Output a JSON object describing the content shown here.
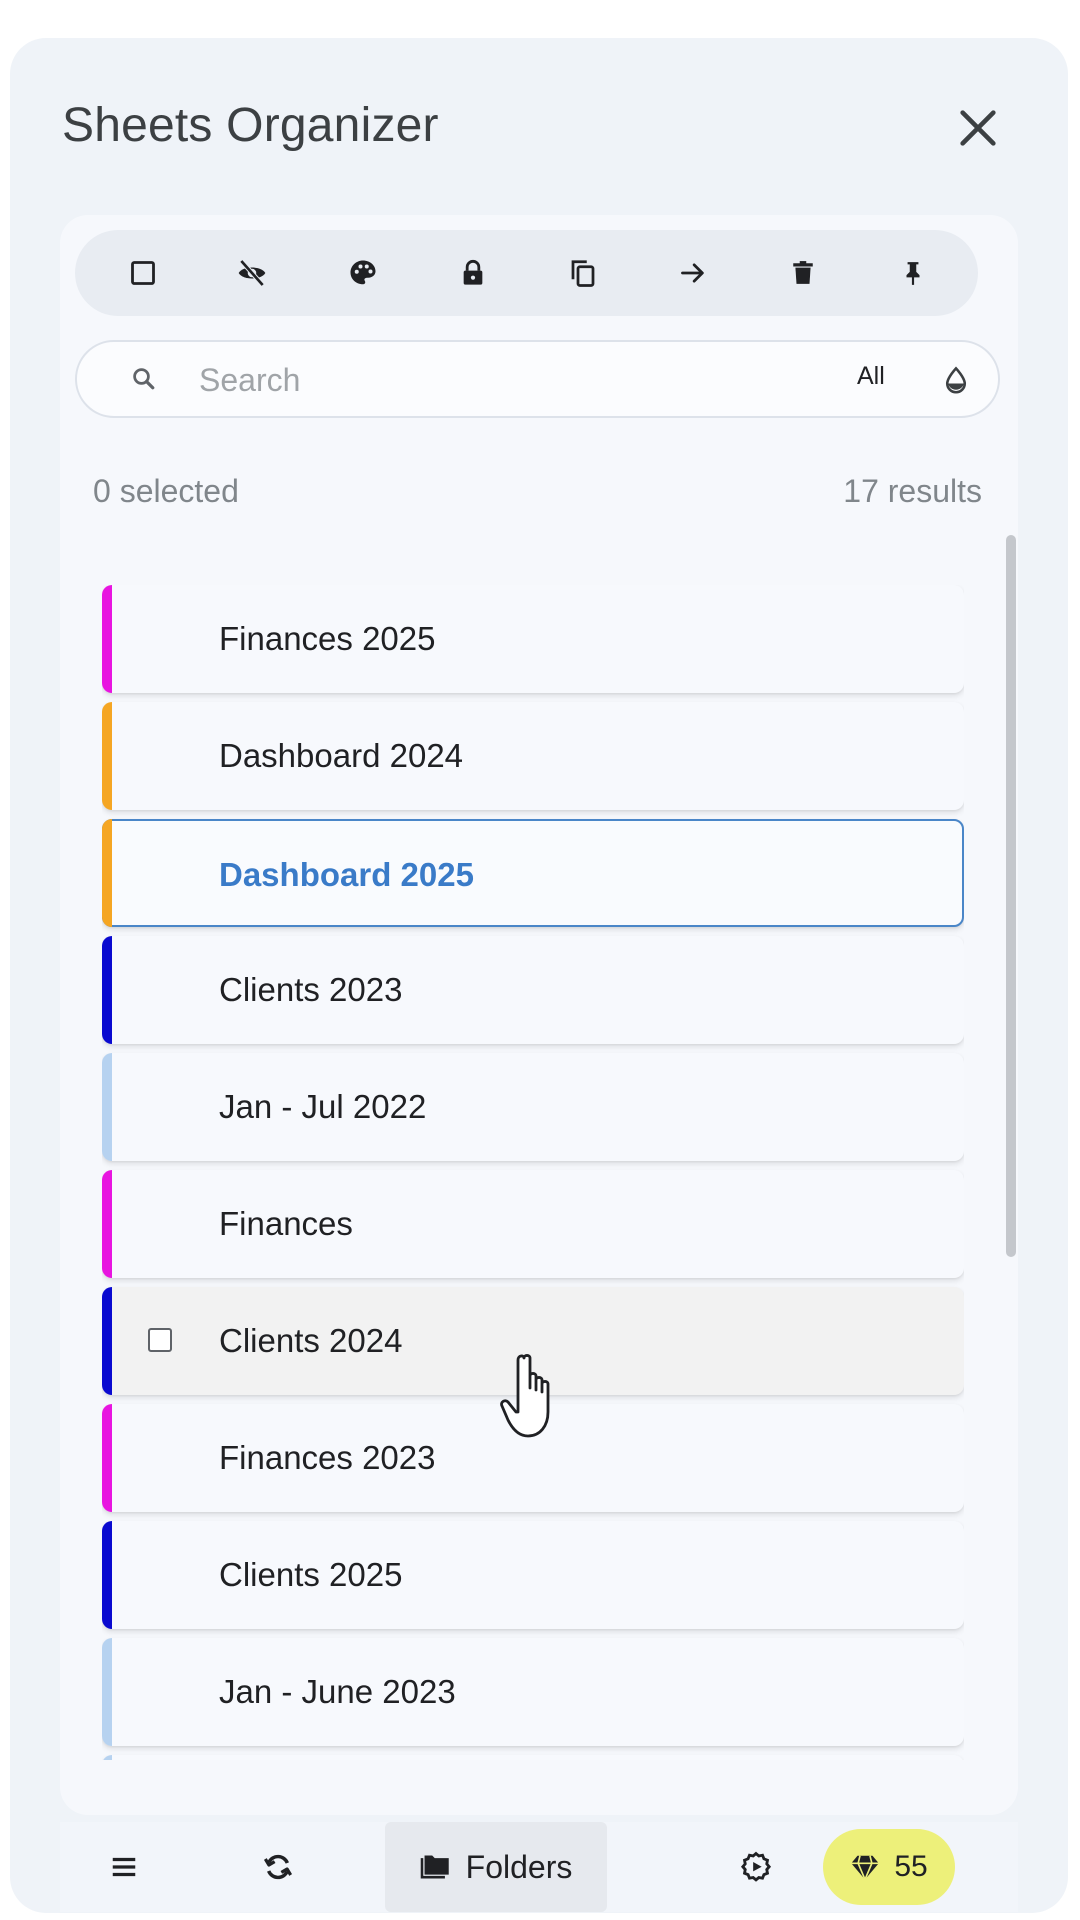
{
  "header": {
    "title": "Sheets Organizer",
    "close_icon": "close-icon"
  },
  "toolbar": {
    "buttons": [
      {
        "name": "select-all",
        "icon": "checkbox-icon"
      },
      {
        "name": "hide",
        "icon": "eye-off-icon"
      },
      {
        "name": "color",
        "icon": "palette-icon"
      },
      {
        "name": "protect",
        "icon": "lock-icon"
      },
      {
        "name": "duplicate",
        "icon": "copy-icon"
      },
      {
        "name": "move",
        "icon": "arrow-right-icon"
      },
      {
        "name": "delete",
        "icon": "trash-icon"
      },
      {
        "name": "pin",
        "icon": "pin-icon"
      }
    ]
  },
  "search": {
    "placeholder": "Search",
    "value": "",
    "filter_label": "All"
  },
  "status": {
    "selected": "0 selected",
    "results": "17 results"
  },
  "sheets": [
    {
      "label": "Finances 2025",
      "color": "#e815e0"
    },
    {
      "label": "Dashboard 2024",
      "color": "#f5a623"
    },
    {
      "label": "Dashboard 2025",
      "color": "#f5a623",
      "active": true
    },
    {
      "label": "Clients 2023",
      "color": "#0a0ad0"
    },
    {
      "label": "Jan - Jul 2022",
      "color": "#b6d2f0"
    },
    {
      "label": "Finances",
      "color": "#e815e0"
    },
    {
      "label": "Clients 2024",
      "color": "#0a0ad0",
      "hovered": true
    },
    {
      "label": "Finances 2023",
      "color": "#e815e0"
    },
    {
      "label": "Clients 2025",
      "color": "#0a0ad0"
    },
    {
      "label": "Jan - June 2023",
      "color": "#b6d2f0"
    }
  ],
  "bottom_nav": {
    "menu_icon": "menu-icon",
    "refresh_icon": "refresh-icon",
    "folders_label": "Folders",
    "settings_icon": "settings-icon",
    "credits_value": "55",
    "credits_icon": "diamond-icon"
  },
  "colors": {
    "accent": "#3a7bc8",
    "credits_badge": "#edf07a",
    "magenta": "#e815e0",
    "orange": "#f5a623",
    "blue": "#0a0ad0",
    "light_blue": "#b6d2f0"
  }
}
